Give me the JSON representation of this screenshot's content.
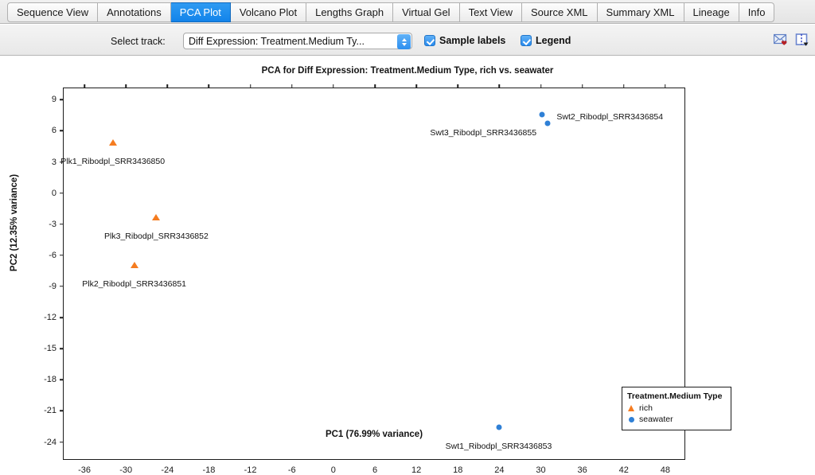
{
  "tabs": [
    {
      "label": "Sequence View",
      "active": false
    },
    {
      "label": "Annotations",
      "active": false
    },
    {
      "label": "PCA Plot",
      "active": true
    },
    {
      "label": "Volcano Plot",
      "active": false
    },
    {
      "label": "Lengths Graph",
      "active": false
    },
    {
      "label": "Virtual Gel",
      "active": false
    },
    {
      "label": "Text View",
      "active": false
    },
    {
      "label": "Source XML",
      "active": false
    },
    {
      "label": "Summary XML",
      "active": false
    },
    {
      "label": "Lineage",
      "active": false
    },
    {
      "label": "Info",
      "active": false
    }
  ],
  "toolbar": {
    "select_track_label": "Select track:",
    "track_value": "Diff Expression: Treatment.Medium Ty...",
    "sample_labels_checkbox": "Sample labels",
    "sample_labels_checked": true,
    "legend_checkbox": "Legend",
    "legend_checked": true,
    "mail_icon": "mail-icon",
    "export_icon": "export-icon"
  },
  "chart_data": {
    "type": "scatter",
    "title": "PCA for Diff Expression: Treatment.Medium Type, rich vs. seawater",
    "xlabel": "PC1 (76.99% variance)",
    "ylabel": "PC2 (12.35% variance)",
    "xlim": [
      -39,
      51
    ],
    "ylim": [
      -25.8,
      10.1
    ],
    "xticks": [
      -36,
      -30,
      -24,
      -18,
      -12,
      -6,
      0,
      6,
      12,
      18,
      24,
      30,
      36,
      42,
      48
    ],
    "yticks": [
      9,
      6,
      3,
      0,
      -3,
      -6,
      -9,
      -12,
      -15,
      -18,
      -21,
      -24
    ],
    "grid": false,
    "legend": {
      "position": "bottom-right",
      "title": "Treatment.Medium Type",
      "entries": [
        {
          "name": "rich",
          "marker": "triangle",
          "color": "#f57c20"
        },
        {
          "name": "seawater",
          "marker": "circle",
          "color": "#2f80d6"
        }
      ]
    },
    "series": [
      {
        "name": "rich",
        "marker": "triangle",
        "color": "#f57c20",
        "points": [
          {
            "label": "Plk1_Ribodpl_SRR3436850",
            "x": -31.9,
            "y": 4.9,
            "label_dx": 0,
            "label_dy": 18
          },
          {
            "label": "Plk3_Ribodpl_SRR3436852",
            "x": -25.6,
            "y": -2.3,
            "label_dx": 0,
            "label_dy": 18
          },
          {
            "label": "Plk2_Ribodpl_SRR3436851",
            "x": -28.8,
            "y": -6.9,
            "label_dx": 0,
            "label_dy": 18
          }
        ]
      },
      {
        "name": "seawater",
        "marker": "circle",
        "color": "#2f80d6",
        "points": [
          {
            "label": "Swt2_Ribodpl_SRR3436854",
            "x": 30.2,
            "y": 7.6,
            "label_dx": 85,
            "label_dy": -3
          },
          {
            "label": "Swt3_Ribodpl_SRR3436855",
            "x": 31.0,
            "y": 6.7,
            "label_dx": -81,
            "label_dy": 6
          },
          {
            "label": "Swt1_Ribodpl_SRR3436853",
            "x": 23.9,
            "y": -22.6,
            "label_dx": 0,
            "label_dy": 18
          }
        ]
      }
    ]
  }
}
